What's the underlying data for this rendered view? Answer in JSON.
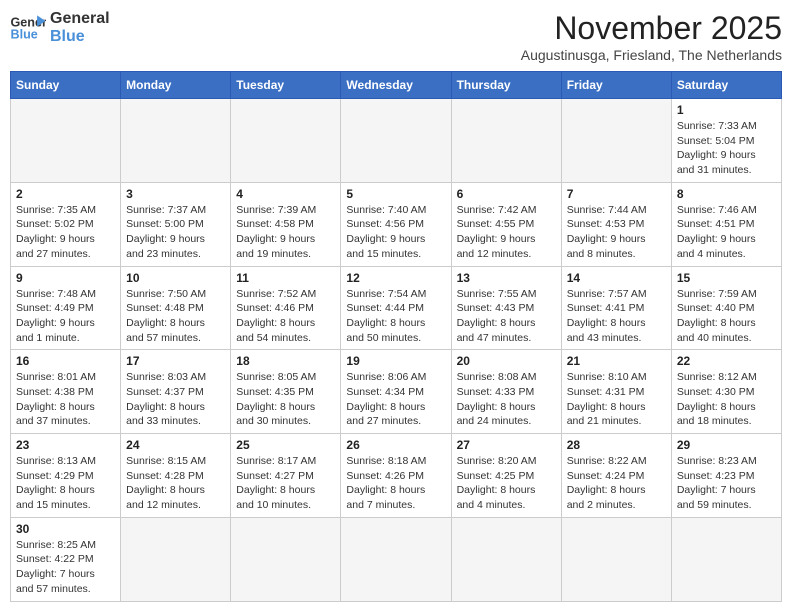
{
  "logo": {
    "text_general": "General",
    "text_blue": "Blue"
  },
  "title": "November 2025",
  "subtitle": "Augustinusga, Friesland, The Netherlands",
  "days_of_week": [
    "Sunday",
    "Monday",
    "Tuesday",
    "Wednesday",
    "Thursday",
    "Friday",
    "Saturday"
  ],
  "weeks": [
    [
      {
        "day": "",
        "info": ""
      },
      {
        "day": "",
        "info": ""
      },
      {
        "day": "",
        "info": ""
      },
      {
        "day": "",
        "info": ""
      },
      {
        "day": "",
        "info": ""
      },
      {
        "day": "",
        "info": ""
      },
      {
        "day": "1",
        "info": "Sunrise: 7:33 AM\nSunset: 5:04 PM\nDaylight: 9 hours and 31 minutes."
      }
    ],
    [
      {
        "day": "2",
        "info": "Sunrise: 7:35 AM\nSunset: 5:02 PM\nDaylight: 9 hours and 27 minutes."
      },
      {
        "day": "3",
        "info": "Sunrise: 7:37 AM\nSunset: 5:00 PM\nDaylight: 9 hours and 23 minutes."
      },
      {
        "day": "4",
        "info": "Sunrise: 7:39 AM\nSunset: 4:58 PM\nDaylight: 9 hours and 19 minutes."
      },
      {
        "day": "5",
        "info": "Sunrise: 7:40 AM\nSunset: 4:56 PM\nDaylight: 9 hours and 15 minutes."
      },
      {
        "day": "6",
        "info": "Sunrise: 7:42 AM\nSunset: 4:55 PM\nDaylight: 9 hours and 12 minutes."
      },
      {
        "day": "7",
        "info": "Sunrise: 7:44 AM\nSunset: 4:53 PM\nDaylight: 9 hours and 8 minutes."
      },
      {
        "day": "8",
        "info": "Sunrise: 7:46 AM\nSunset: 4:51 PM\nDaylight: 9 hours and 4 minutes."
      }
    ],
    [
      {
        "day": "9",
        "info": "Sunrise: 7:48 AM\nSunset: 4:49 PM\nDaylight: 9 hours and 1 minute."
      },
      {
        "day": "10",
        "info": "Sunrise: 7:50 AM\nSunset: 4:48 PM\nDaylight: 8 hours and 57 minutes."
      },
      {
        "day": "11",
        "info": "Sunrise: 7:52 AM\nSunset: 4:46 PM\nDaylight: 8 hours and 54 minutes."
      },
      {
        "day": "12",
        "info": "Sunrise: 7:54 AM\nSunset: 4:44 PM\nDaylight: 8 hours and 50 minutes."
      },
      {
        "day": "13",
        "info": "Sunrise: 7:55 AM\nSunset: 4:43 PM\nDaylight: 8 hours and 47 minutes."
      },
      {
        "day": "14",
        "info": "Sunrise: 7:57 AM\nSunset: 4:41 PM\nDaylight: 8 hours and 43 minutes."
      },
      {
        "day": "15",
        "info": "Sunrise: 7:59 AM\nSunset: 4:40 PM\nDaylight: 8 hours and 40 minutes."
      }
    ],
    [
      {
        "day": "16",
        "info": "Sunrise: 8:01 AM\nSunset: 4:38 PM\nDaylight: 8 hours and 37 minutes."
      },
      {
        "day": "17",
        "info": "Sunrise: 8:03 AM\nSunset: 4:37 PM\nDaylight: 8 hours and 33 minutes."
      },
      {
        "day": "18",
        "info": "Sunrise: 8:05 AM\nSunset: 4:35 PM\nDaylight: 8 hours and 30 minutes."
      },
      {
        "day": "19",
        "info": "Sunrise: 8:06 AM\nSunset: 4:34 PM\nDaylight: 8 hours and 27 minutes."
      },
      {
        "day": "20",
        "info": "Sunrise: 8:08 AM\nSunset: 4:33 PM\nDaylight: 8 hours and 24 minutes."
      },
      {
        "day": "21",
        "info": "Sunrise: 8:10 AM\nSunset: 4:31 PM\nDaylight: 8 hours and 21 minutes."
      },
      {
        "day": "22",
        "info": "Sunrise: 8:12 AM\nSunset: 4:30 PM\nDaylight: 8 hours and 18 minutes."
      }
    ],
    [
      {
        "day": "23",
        "info": "Sunrise: 8:13 AM\nSunset: 4:29 PM\nDaylight: 8 hours and 15 minutes."
      },
      {
        "day": "24",
        "info": "Sunrise: 8:15 AM\nSunset: 4:28 PM\nDaylight: 8 hours and 12 minutes."
      },
      {
        "day": "25",
        "info": "Sunrise: 8:17 AM\nSunset: 4:27 PM\nDaylight: 8 hours and 10 minutes."
      },
      {
        "day": "26",
        "info": "Sunrise: 8:18 AM\nSunset: 4:26 PM\nDaylight: 8 hours and 7 minutes."
      },
      {
        "day": "27",
        "info": "Sunrise: 8:20 AM\nSunset: 4:25 PM\nDaylight: 8 hours and 4 minutes."
      },
      {
        "day": "28",
        "info": "Sunrise: 8:22 AM\nSunset: 4:24 PM\nDaylight: 8 hours and 2 minutes."
      },
      {
        "day": "29",
        "info": "Sunrise: 8:23 AM\nSunset: 4:23 PM\nDaylight: 7 hours and 59 minutes."
      }
    ],
    [
      {
        "day": "30",
        "info": "Sunrise: 8:25 AM\nSunset: 4:22 PM\nDaylight: 7 hours and 57 minutes."
      },
      {
        "day": "",
        "info": ""
      },
      {
        "day": "",
        "info": ""
      },
      {
        "day": "",
        "info": ""
      },
      {
        "day": "",
        "info": ""
      },
      {
        "day": "",
        "info": ""
      },
      {
        "day": "",
        "info": ""
      }
    ]
  ]
}
